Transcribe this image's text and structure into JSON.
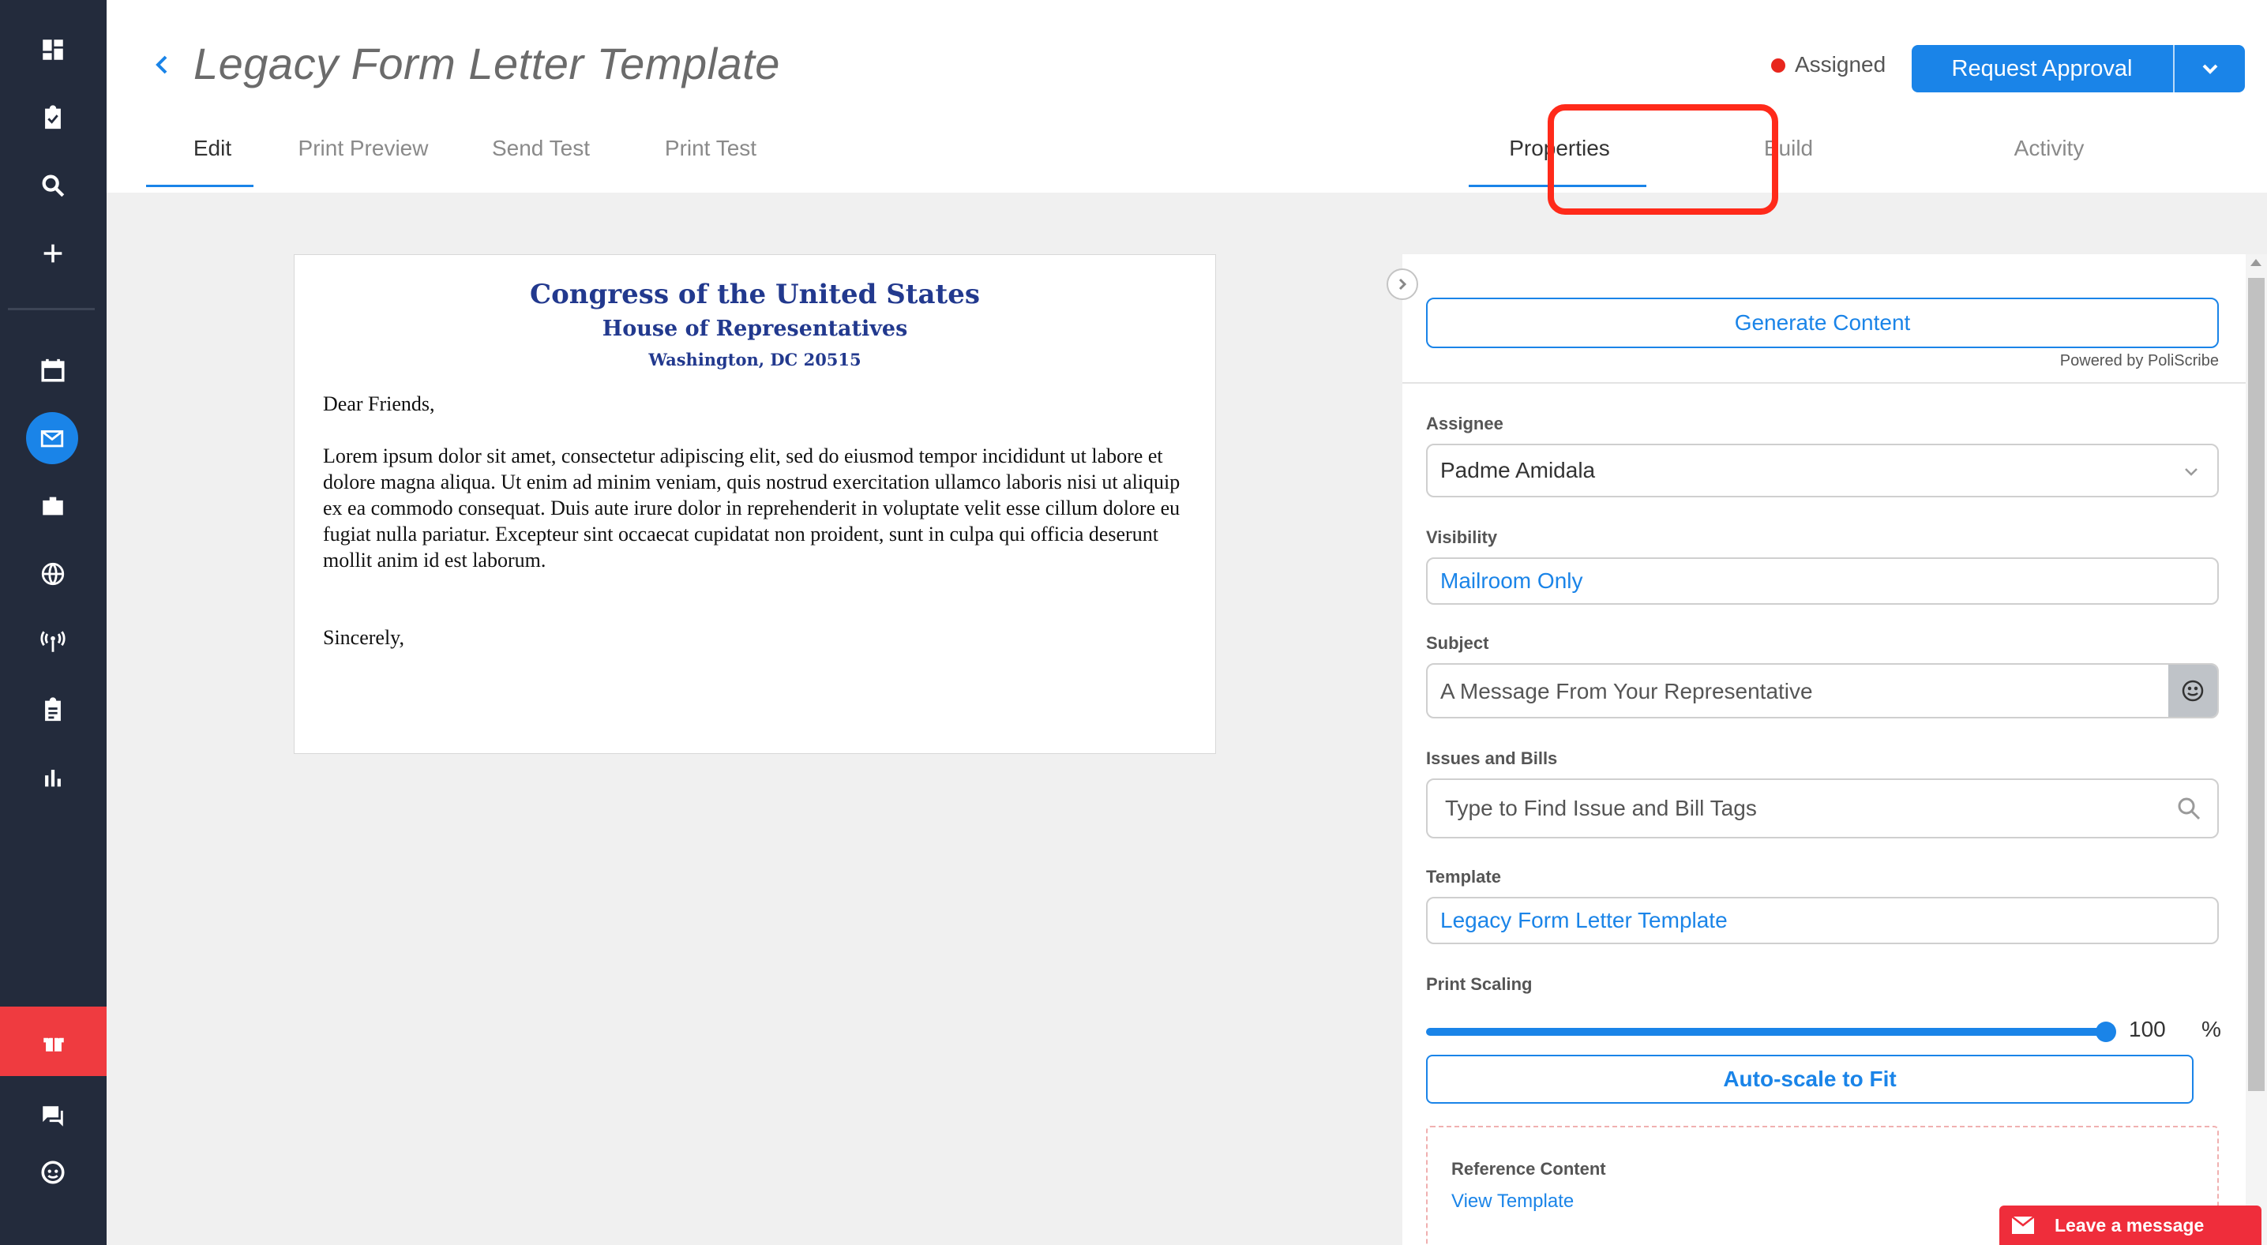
{
  "header": {
    "title": "Legacy Form Letter Template",
    "status": "Assigned",
    "status_color": "#e8261d",
    "request_button": "Request Approval"
  },
  "tabs": [
    {
      "label": "Edit",
      "active": true
    },
    {
      "label": "Print Preview",
      "active": false
    },
    {
      "label": "Send Test",
      "active": false
    },
    {
      "label": "Print Test",
      "active": false
    },
    {
      "label": "Properties",
      "active": true
    },
    {
      "label": "Build",
      "active": false
    },
    {
      "label": "Activity",
      "active": false
    }
  ],
  "sidebar": {
    "icons": [
      "dashboard-icon",
      "task-icon",
      "search-icon",
      "add-icon",
      "calendar-icon",
      "mail-icon",
      "briefcase-icon",
      "globe-icon",
      "broadcast-icon",
      "clipboard-icon",
      "chart-icon",
      "gift-icon",
      "chat-icon",
      "face-icon"
    ]
  },
  "letter": {
    "heading1": "Congress of the United States",
    "heading2": "House of Representatives",
    "heading3": "Washington, DC 20515",
    "greeting": "Dear Friends,",
    "body": "Lorem ipsum dolor sit amet, consectetur adipiscing elit, sed do eiusmod tempor incididunt ut labore et dolore magna aliqua. Ut enim ad minim veniam, quis nostrud exercitation ullamco laboris nisi ut aliquip ex ea commodo consequat. Duis aute irure dolor in reprehenderit in voluptate velit esse cillum dolore eu fugiat nulla pariatur. Excepteur sint occaecat cupidatat non proident, sunt in culpa qui officia deserunt mollit anim id est laborum.",
    "closing": "Sincerely,"
  },
  "panel": {
    "generate_button": "Generate Content",
    "powered_by": "Powered by PoliScribe",
    "assignee_label": "Assignee",
    "assignee_value": "Padme Amidala",
    "visibility_label": "Visibility",
    "visibility_value": "Mailroom Only",
    "subject_label": "Subject",
    "subject_value": "A Message From Your Representative",
    "issues_label": "Issues and Bills",
    "issues_placeholder": "Type to Find Issue and Bill Tags",
    "template_label": "Template",
    "template_value": "Legacy Form Letter Template",
    "print_scaling_label": "Print Scaling",
    "print_scaling_value": "100",
    "print_scaling_unit": "%",
    "print_scaling_fraction": 1.0,
    "autoscale_button": "Auto-scale to Fit",
    "reference_title": "Reference Content",
    "reference_link": "View Template"
  },
  "chat": {
    "label": "Leave a message"
  },
  "colors": {
    "accent": "#1a84e8",
    "sidebar": "#232b3c",
    "highlight": "#ff2a1a"
  }
}
